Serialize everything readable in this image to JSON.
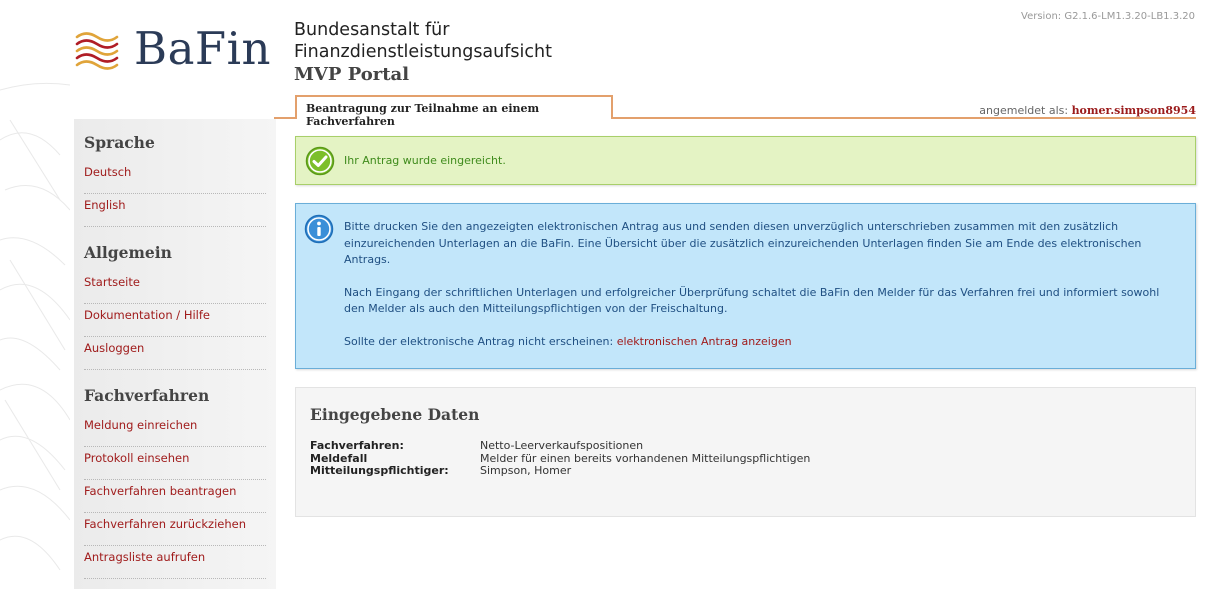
{
  "header": {
    "logo_text": "BaFin",
    "org_line1": "Bundesanstalt für",
    "org_line2": "Finanzdienstleistungsaufsicht",
    "portal": "MVP Portal",
    "version": "Version: G2.1.6-LM1.3.20-LB1.3.20"
  },
  "tab": {
    "label": "Beantragung zur Teilnahme an einem Fachverfahren"
  },
  "login": {
    "prefix": "angemeldet als:",
    "user": "homer.simpson8954"
  },
  "sidebar": {
    "sections": [
      {
        "title": "Sprache",
        "items": [
          "Deutsch",
          "English"
        ]
      },
      {
        "title": "Allgemein",
        "items": [
          "Startseite",
          "Dokumentation / Hilfe",
          "Ausloggen"
        ]
      },
      {
        "title": "Fachverfahren",
        "items": [
          "Meldung einreichen",
          "Protokoll einsehen",
          "Fachverfahren beantragen",
          "Fachverfahren zurückziehen",
          "Antragsliste aufrufen"
        ]
      }
    ]
  },
  "success": {
    "message": "Ihr Antrag wurde eingereicht."
  },
  "info": {
    "p1": "Bitte drucken Sie den angezeigten elektronischen Antrag aus und senden diesen unverzüglich unterschrieben zusammen mit den zusätzlich einzureichenden Unterlagen an die BaFin. Eine Übersicht über die zusätzlich einzureichenden Unterlagen finden Sie am Ende des elektronischen Antrags.",
    "p2": "Nach Eingang der schriftlichen Unterlagen und erfolgreicher Überprüfung schaltet die BaFin den Melder für das Verfahren frei und informiert sowohl den Melder als auch den Mitteilungspflichtigen von der Freischaltung.",
    "p3_prefix": "Sollte der elektronische Antrag nicht erscheinen:",
    "p3_link": "elektronischen Antrag anzeigen"
  },
  "data_section": {
    "title": "Eingegebene Daten",
    "rows": [
      {
        "label": "Fachverfahren:",
        "value": "Netto-Leerverkaufspositionen"
      },
      {
        "label": "Meldefall",
        "value": "Melder für einen bereits vorhandenen Mitteilungspflichtigen"
      },
      {
        "label": "Mitteilungspflichtiger:",
        "value": "Simpson, Homer"
      }
    ]
  },
  "colors": {
    "accent": "#e3a06c",
    "link": "#a01c1c",
    "success_bg": "#e4f3c4",
    "info_bg": "#c2e6fa"
  }
}
